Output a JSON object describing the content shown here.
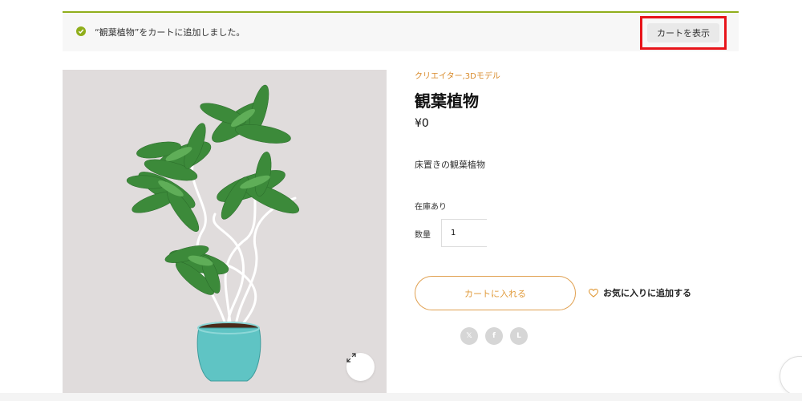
{
  "notice": {
    "message": "“観葉植物”をカートに追加しました。",
    "view_cart_label": "カートを表示",
    "icon": "check-circle-icon"
  },
  "product": {
    "categories": [
      "クリエイター",
      "3Dモデル"
    ],
    "category_separator": ",",
    "title": "観葉植物",
    "price": "¥0",
    "description": "床置きの観葉植物",
    "stock": "在庫あり",
    "quantity_label": "数量",
    "quantity_value": "1",
    "add_to_cart_label": "カートに入れる",
    "wishlist_label": "お気に入りに追加する"
  },
  "share": [
    {
      "icon": "x-icon",
      "glyph": "𝕏"
    },
    {
      "icon": "facebook-icon",
      "glyph": "f"
    },
    {
      "icon": "line-icon",
      "glyph": "L"
    }
  ],
  "colors": {
    "accent": "#d98b2b",
    "notice_border": "#8fae1b",
    "highlight": "#e8141a",
    "image_bg": "#e0dcdc"
  }
}
